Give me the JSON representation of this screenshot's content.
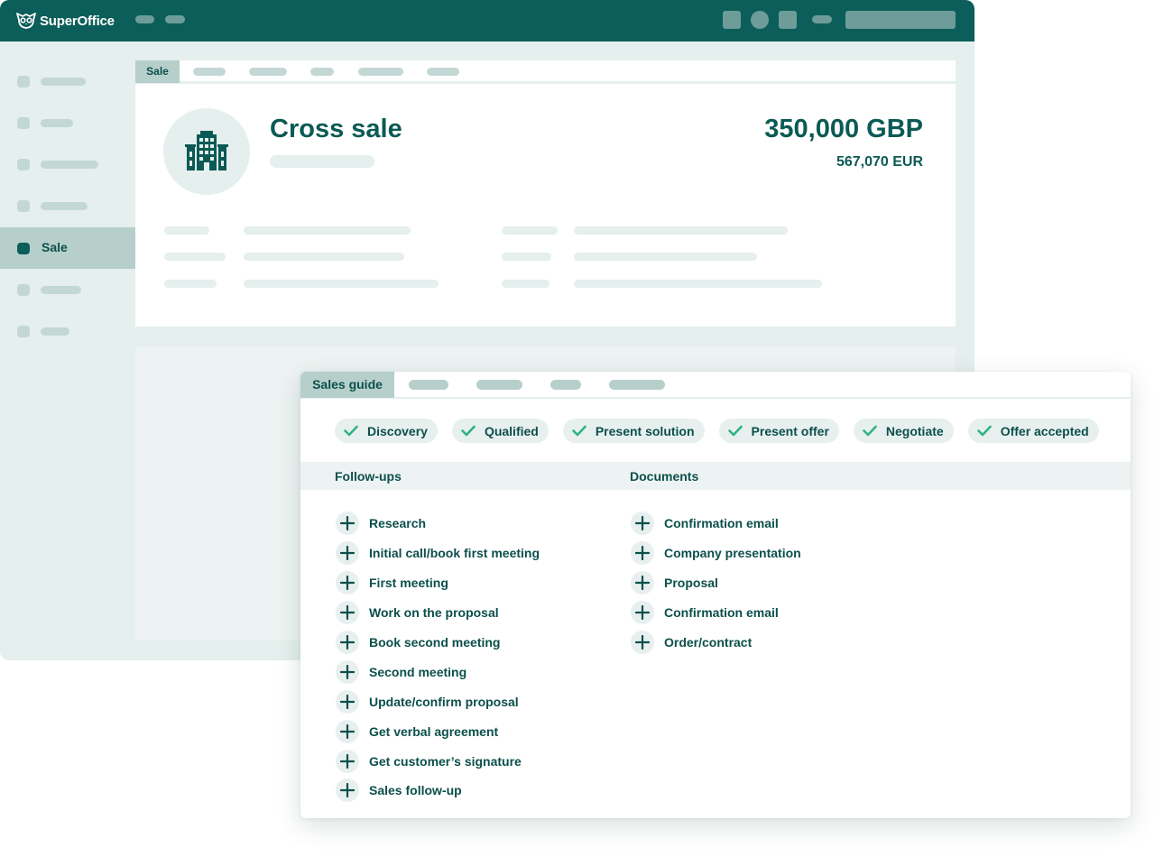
{
  "app": {
    "brand": "SuperOffice"
  },
  "sidebar": {
    "active_label": "Sale"
  },
  "sale_tabs": {
    "active": "Sale"
  },
  "sale": {
    "title": "Cross sale",
    "amount": "350,000 GBP",
    "amount_converted": "567,070 EUR"
  },
  "guide": {
    "active_tab": "Sales guide",
    "stages": [
      {
        "label": "Discovery",
        "done": true
      },
      {
        "label": "Qualified",
        "done": true
      },
      {
        "label": "Present solution",
        "done": true
      },
      {
        "label": "Present offer",
        "done": true
      },
      {
        "label": "Negotiate",
        "done": true
      },
      {
        "label": "Offer accepted",
        "done": true
      }
    ],
    "followups_title": "Follow-ups",
    "documents_title": "Documents",
    "followups": [
      "Research",
      "Initial call/book first meeting",
      "First meeting",
      "Work on the proposal",
      "Book second meeting",
      "Second meeting",
      "Update/confirm proposal",
      "Get verbal agreement",
      "Get customer’s signature",
      "Sales follow-up"
    ],
    "documents": [
      "Confirmation email",
      "Company presentation",
      "Proposal",
      "Confirmation email",
      "Order/contract"
    ]
  },
  "colors": {
    "brand": "#0b5e59",
    "text": "#0b4f4b",
    "check": "#2fb383",
    "placeholder": "#c3d8d5"
  },
  "icons": {
    "logo": "owl-logo-icon",
    "sale_avatar": "building-icon",
    "stage_done": "check-icon",
    "add": "plus-icon"
  }
}
